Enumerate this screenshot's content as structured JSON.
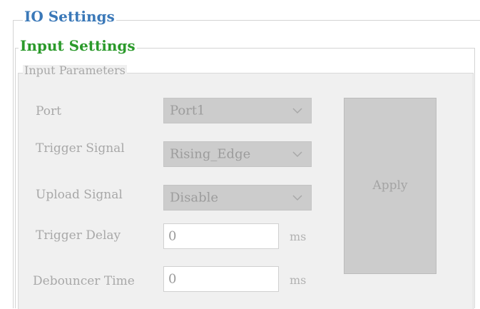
{
  "groups": {
    "io_title": "IO Settings",
    "input_title": "Input Settings",
    "params_title": "Input Parameters"
  },
  "colors": {
    "io_title": "#3a78b8",
    "input_title": "#2b9a2b",
    "disabled_text": "#a8a8a8",
    "combo_bg": "#cccccc",
    "panel_bg": "#f0f0f0"
  },
  "fields": {
    "port": {
      "label": "Port",
      "value": "Port1",
      "icon": "chevron-down-icon"
    },
    "trigger_signal": {
      "label": "Trigger Signal",
      "value": "Rising_Edge",
      "icon": "chevron-down-icon"
    },
    "upload_signal": {
      "label": "Upload Signal",
      "value": "Disable",
      "icon": "chevron-down-icon"
    },
    "trigger_delay": {
      "label": "Trigger Delay",
      "value": "0",
      "unit": "ms"
    },
    "debouncer_time": {
      "label": "Debouncer Time",
      "value": "0",
      "unit": "ms"
    }
  },
  "apply_label": "Apply"
}
